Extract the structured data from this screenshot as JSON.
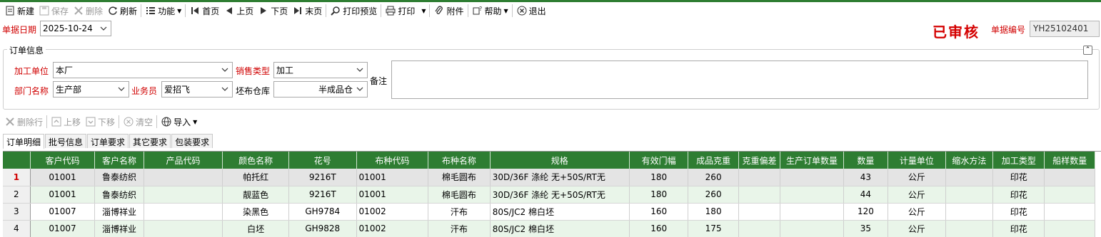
{
  "toolbar": {
    "new": "新建",
    "save": "保存",
    "delete": "删除",
    "refresh": "刷新",
    "functions": "功能",
    "first": "首页",
    "prev": "上页",
    "next": "下页",
    "last": "末页",
    "print_preview": "打印预览",
    "print": "打印",
    "attachment": "附件",
    "help": "帮助",
    "exit": "退出"
  },
  "header": {
    "date_label": "单据日期",
    "date_value": "2025-10-24",
    "stamp": "已审核",
    "doc_no_label": "单据编号",
    "doc_no_value": "YH25102401"
  },
  "order_info": {
    "title": "订单信息",
    "processing_unit_label": "加工单位",
    "processing_unit_value": "本厂",
    "sales_type_label": "销售类型",
    "sales_type_value": "加工",
    "remarks_label": "备注",
    "remarks_value": "",
    "department_label": "部门名称",
    "department_value": "生产部",
    "salesman_label": "业务员",
    "salesman_value": "爱招飞",
    "warehouse_label": "坯布仓库",
    "warehouse_value": "半成品仓"
  },
  "grid_toolbar": {
    "delete_row": "删除行",
    "move_up": "上移",
    "move_down": "下移",
    "clear": "清空",
    "import": "导入"
  },
  "tabs": [
    "订单明细",
    "批号信息",
    "订单要求",
    "其它要求",
    "包装要求"
  ],
  "table": {
    "columns": [
      "",
      "客户代码",
      "客户名称",
      "产品代码",
      "颜色名称",
      "花号",
      "布种代码",
      "布种名称",
      "规格",
      "有效门幅",
      "成品克重",
      "克重偏差",
      "生产订单数量",
      "数量",
      "计量单位",
      "缩水方法",
      "加工类型",
      "船样数量"
    ],
    "rows": [
      [
        "1",
        "01001",
        "鲁泰纺织",
        "",
        "帕托红",
        "9216T",
        "01001",
        "棉毛圆布",
        "30D/36F  涤纶   无+50S/RT无",
        "180",
        "260",
        "",
        "",
        "43",
        "公斤",
        "",
        "印花",
        ""
      ],
      [
        "2",
        "01001",
        "鲁泰纺织",
        "",
        "靓蓝色",
        "9216T",
        "01001",
        "棉毛圆布",
        "30D/36F  涤纶   无+50S/RT无",
        "180",
        "260",
        "",
        "",
        "44",
        "公斤",
        "",
        "印花",
        ""
      ],
      [
        "3",
        "01007",
        "淄博祥业",
        "",
        "染黑色",
        "GH9784",
        "01002",
        "汗布",
        "80S/JC2  棉白坯",
        "160",
        "180",
        "",
        "",
        "120",
        "公斤",
        "",
        "印花",
        ""
      ],
      [
        "4",
        "01007",
        "淄博祥业",
        "",
        "白坯",
        "GH9828",
        "01002",
        "汗布",
        "80S/JC2  棉白坯",
        "160",
        "175",
        "",
        "",
        "35",
        "公斤",
        "",
        "印花",
        ""
      ]
    ]
  },
  "colors": {
    "header_green": "#2e7d32",
    "label_red": "#d00000",
    "stamp_red": "#d40000",
    "row_alt": "#e9f5e9"
  }
}
